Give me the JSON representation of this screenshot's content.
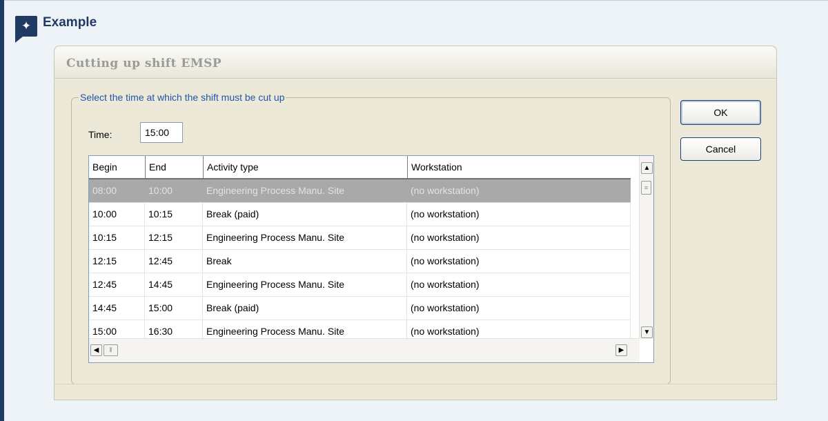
{
  "callout": {
    "icon": "sparkle-icon",
    "title": "Example"
  },
  "dialog": {
    "title": "Cutting up shift  EMSP",
    "group_label": "Select the time at which the shift must be cut up",
    "time_label": "Time:",
    "time_value": "15:00",
    "ok_label": "OK",
    "cancel_label": "Cancel"
  },
  "table": {
    "columns": [
      "Begin",
      "End",
      "Activity type",
      "Workstation"
    ],
    "rows": [
      [
        "08:00",
        "10:00",
        "Engineering Process Manu. Site",
        "(no workstation)"
      ],
      [
        "10:00",
        "10:15",
        "Break (paid)",
        "(no workstation)"
      ],
      [
        "10:15",
        "12:15",
        "Engineering Process Manu. Site",
        "(no workstation)"
      ],
      [
        "12:15",
        "12:45",
        "Break",
        "(no workstation)"
      ],
      [
        "12:45",
        "14:45",
        "Engineering Process Manu. Site",
        "(no workstation)"
      ],
      [
        "14:45",
        "15:00",
        "Break (paid)",
        "(no workstation)"
      ],
      [
        "15:00",
        "16:30",
        "Engineering Process Manu. Site",
        "(no workstation)"
      ]
    ],
    "selected_row": 0
  },
  "colors": {
    "accent": "#1f3a63",
    "legend_text": "#1f55a8",
    "selection": "#a9a9a9"
  }
}
